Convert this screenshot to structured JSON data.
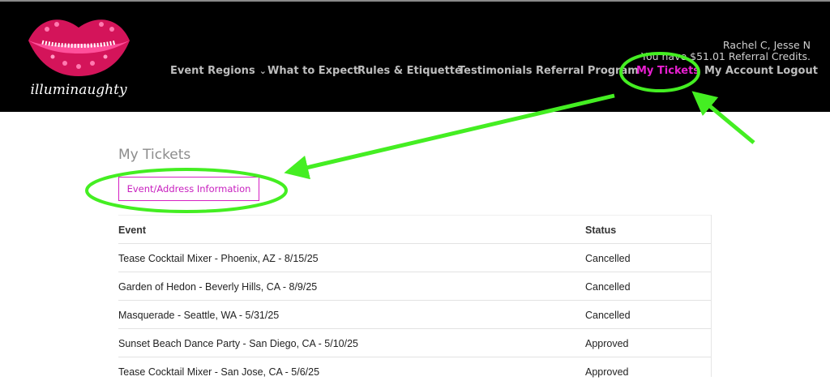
{
  "brand": {
    "script_text": "illuminaughty"
  },
  "user": {
    "names": "Rachel C, Jesse N",
    "credits": "You have $51.01 Referral Credits."
  },
  "nav": {
    "items": [
      {
        "label": "Event Regions",
        "has_dropdown": true
      },
      {
        "label": "What to Expect"
      },
      {
        "label": "Rules & Etiquette"
      },
      {
        "label": "Testimonials"
      },
      {
        "label": "Referral Program"
      },
      {
        "label": "My Tickets",
        "active": true
      },
      {
        "label": "My Account"
      },
      {
        "label": "Logout"
      }
    ],
    "dropdown_icon": "chevron-down-icon"
  },
  "page": {
    "title": "My Tickets",
    "info_button": "Event/Address Information"
  },
  "tickets": {
    "columns": [
      "Event",
      "Status"
    ],
    "rows": [
      {
        "event": "Tease Cocktail Mixer - Phoenix, AZ - 8/15/25",
        "status": "Cancelled"
      },
      {
        "event": "Garden of Hedon - Beverly Hills, CA - 8/9/25",
        "status": "Cancelled"
      },
      {
        "event": "Masquerade - Seattle, WA - 5/31/25",
        "status": "Cancelled"
      },
      {
        "event": "Sunset Beach Dance Party - San Diego, CA - 5/10/25",
        "status": "Approved"
      },
      {
        "event": "Tease Cocktail Mixer - San Jose, CA - 5/6/25",
        "status": "Approved"
      }
    ]
  },
  "colors": {
    "header_bg": "#000000",
    "accent": "#e91fd1",
    "annotation": "#44ee22"
  }
}
